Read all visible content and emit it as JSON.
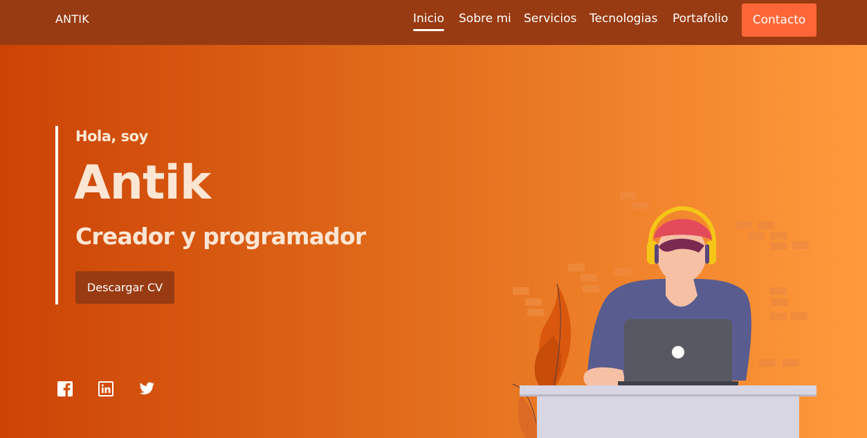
{
  "nav": {
    "brand": "ANTIK",
    "links": [
      {
        "label": "Inicio"
      },
      {
        "label": "Sobre mi"
      },
      {
        "label": "Servicios"
      },
      {
        "label": "Tecnologias"
      },
      {
        "label": "Portafolio"
      }
    ],
    "contact_label": "Contacto"
  },
  "hero": {
    "greeting": "Hola, soy",
    "name": "Antik",
    "role": "Creador y programador",
    "cv_label": "Descargar CV"
  },
  "social": [
    {
      "icon": "facebook-icon"
    },
    {
      "icon": "linkedin-icon"
    },
    {
      "icon": "twitter-icon"
    }
  ],
  "colors": {
    "nav_bg": "#983b12",
    "accent": "#ff6637",
    "hero_gradient_start": "#cc4306",
    "hero_gradient_end": "#ff9a3c"
  }
}
